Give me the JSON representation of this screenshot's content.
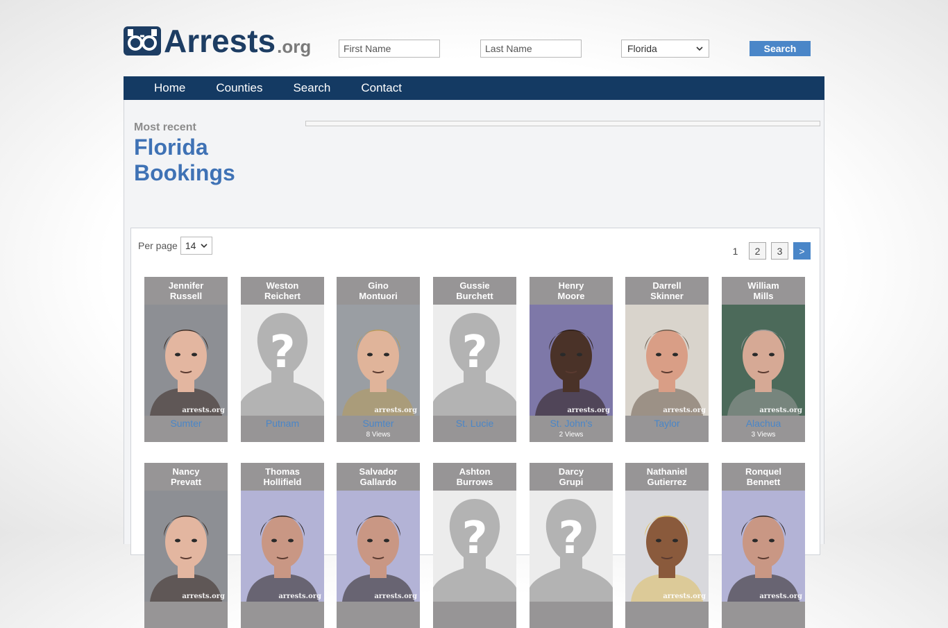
{
  "brand": {
    "name": "Arrests",
    "tld": ".org"
  },
  "search": {
    "first_placeholder": "First Name",
    "last_placeholder": "Last Name",
    "state": "Florida",
    "button": "Search"
  },
  "nav": [
    "Home",
    "Counties",
    "Search",
    "Contact"
  ],
  "heading": {
    "kicker": "Most recent",
    "title_line1": "Florida",
    "title_line2": "Bookings"
  },
  "listing": {
    "per_page_label": "Per page",
    "per_page_value": "14",
    "pages": [
      "1",
      "2",
      "3",
      ">"
    ],
    "watermark": "arrests.org",
    "row1": [
      {
        "first": "Jennifer",
        "last": "Russell",
        "county": "Sumter",
        "views": "",
        "photo": "mugshot-woman"
      },
      {
        "first": "Weston",
        "last": "Reichert",
        "county": "Putnam",
        "views": "",
        "photo": "placeholder"
      },
      {
        "first": "Gino",
        "last": "Montuori",
        "county": "Sumter",
        "views": "8 Views",
        "photo": "mugshot-young-man"
      },
      {
        "first": "Gussie",
        "last": "Burchett",
        "county": "St. Lucie",
        "views": "",
        "photo": "placeholder"
      },
      {
        "first": "Henry",
        "last": "Moore",
        "county": "St. John's",
        "views": "2 Views",
        "photo": "mugshot-older-man"
      },
      {
        "first": "Darrell",
        "last": "Skinner",
        "county": "Taylor",
        "views": "",
        "photo": "mugshot-man-orange"
      },
      {
        "first": "William",
        "last": "Mills",
        "county": "Alachua",
        "views": "3 Views",
        "photo": "mugshot-man-green"
      }
    ],
    "row2": [
      {
        "first": "Nancy",
        "last": "Prevatt",
        "photo": "mugshot-woman"
      },
      {
        "first": "Thomas",
        "last": "Hollifield",
        "photo": "mugshot-man"
      },
      {
        "first": "Salvador",
        "last": "Gallardo",
        "photo": "mugshot-man"
      },
      {
        "first": "Ashton",
        "last": "Burrows",
        "photo": "placeholder"
      },
      {
        "first": "Darcy",
        "last": "Grupi",
        "photo": "placeholder"
      },
      {
        "first": "Nathaniel",
        "last": "Gutierrez",
        "photo": "mugshot-blonde"
      },
      {
        "first": "Ronquel",
        "last": "Bennett",
        "photo": "mugshot-man"
      }
    ]
  }
}
